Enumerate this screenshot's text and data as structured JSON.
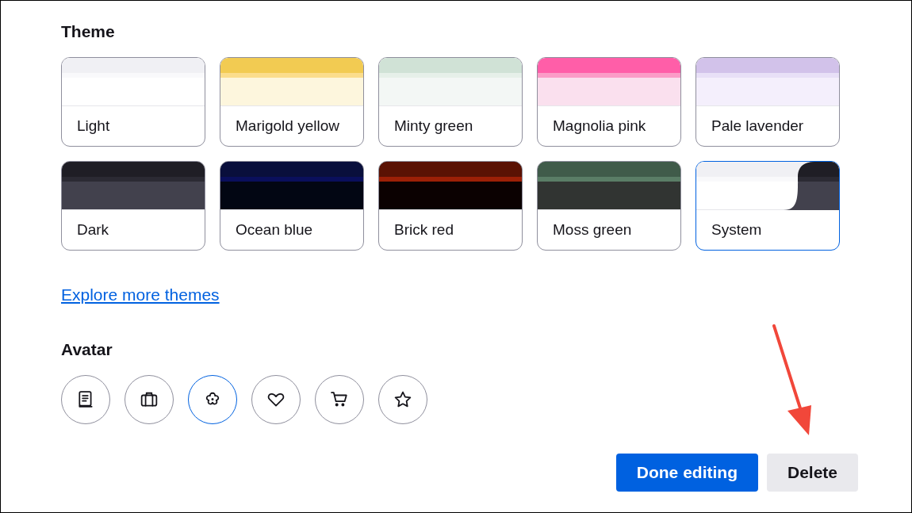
{
  "theme": {
    "heading": "Theme",
    "options": [
      {
        "label": "Light",
        "kind": "light",
        "selected": false
      },
      {
        "label": "Marigold yellow",
        "kind": "marigold",
        "selected": false
      },
      {
        "label": "Minty green",
        "kind": "minty",
        "selected": false
      },
      {
        "label": "Magnolia pink",
        "kind": "magnolia",
        "selected": false
      },
      {
        "label": "Pale lavender",
        "kind": "lavender",
        "selected": false
      },
      {
        "label": "Dark",
        "kind": "dark",
        "selected": false
      },
      {
        "label": "Ocean blue",
        "kind": "ocean",
        "selected": false
      },
      {
        "label": "Brick red",
        "kind": "brick",
        "selected": false
      },
      {
        "label": "Moss green",
        "kind": "moss",
        "selected": false
      },
      {
        "label": "System",
        "kind": "system",
        "selected": true
      }
    ]
  },
  "explore_link": "Explore more themes",
  "avatar": {
    "heading": "Avatar",
    "options": [
      {
        "kind": "book",
        "selected": false
      },
      {
        "kind": "briefcase",
        "selected": false
      },
      {
        "kind": "flower",
        "selected": true
      },
      {
        "kind": "heart",
        "selected": false
      },
      {
        "kind": "cart",
        "selected": false
      },
      {
        "kind": "star",
        "selected": false
      }
    ]
  },
  "buttons": [
    {
      "label": "Done editing",
      "kind": "primary"
    },
    {
      "label": "Delete",
      "kind": "secondary"
    }
  ]
}
